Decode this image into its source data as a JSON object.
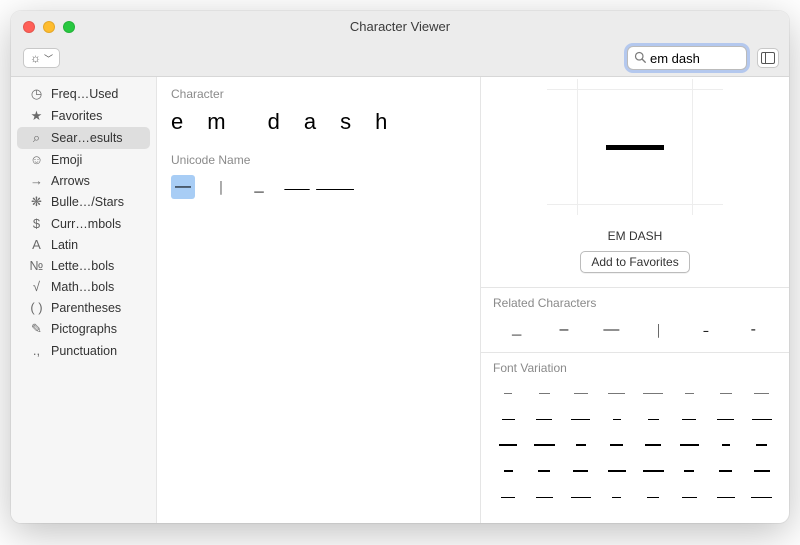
{
  "window": {
    "title": "Character Viewer"
  },
  "search": {
    "value": "em dash"
  },
  "sidebar": {
    "items": [
      {
        "icon": "clock",
        "label": "Freq…Used"
      },
      {
        "icon": "star",
        "label": "Favorites"
      },
      {
        "icon": "search",
        "label": "Sear…esults",
        "selected": true
      },
      {
        "icon": "emoji",
        "label": "Emoji"
      },
      {
        "icon": "arrow",
        "label": "Arrows"
      },
      {
        "icon": "asterisk",
        "label": "Bulle…/Stars"
      },
      {
        "icon": "dollar",
        "label": "Curr…mbols"
      },
      {
        "icon": "latin",
        "label": "Latin"
      },
      {
        "icon": "no",
        "label": "Lette…bols"
      },
      {
        "icon": "sqrt",
        "label": "Math…bols"
      },
      {
        "icon": "paren",
        "label": "Parentheses"
      },
      {
        "icon": "picto",
        "label": "Pictographs"
      },
      {
        "icon": "punct",
        "label": "Punctuation"
      }
    ]
  },
  "middle": {
    "character_label": "Character",
    "query_display": [
      "e",
      "m",
      "d",
      "a",
      "s",
      "h"
    ],
    "unicode_label": "Unicode Name",
    "results": [
      {
        "glyph": "—",
        "selected": true
      },
      {
        "glyph": "︱"
      },
      {
        "glyph": "﹘"
      },
      {
        "glyph": "⸺"
      },
      {
        "glyph": "⸻"
      }
    ]
  },
  "detail": {
    "char_name": "EM DASH",
    "add_fav": "Add to Favorites",
    "related_label": "Related Characters",
    "related": [
      "﹘",
      "–",
      "—",
      "︱",
      "˗",
      "-"
    ],
    "fontvar_label": "Font Variation",
    "font_variations_rows": 5,
    "font_variations_cols": 8
  }
}
